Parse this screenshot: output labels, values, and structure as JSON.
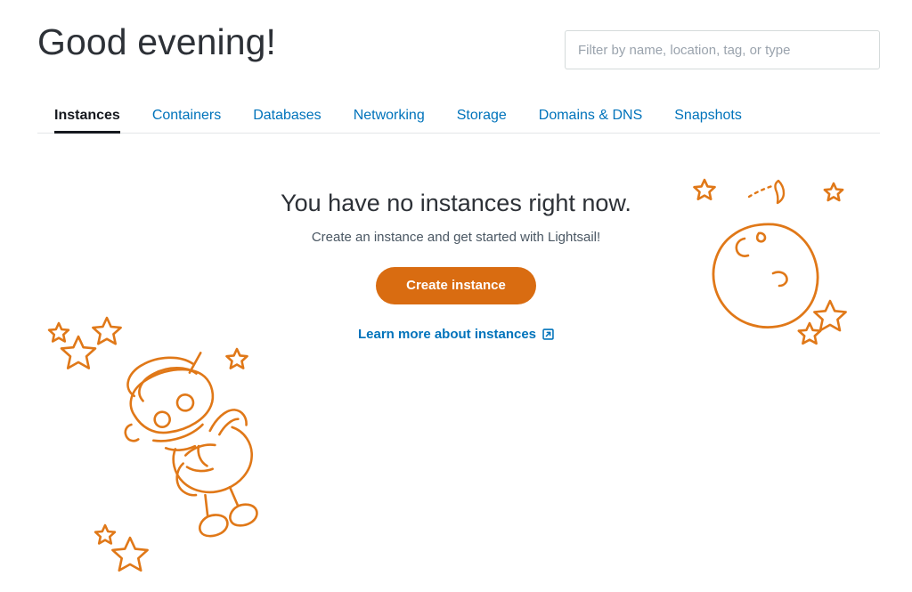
{
  "header": {
    "greeting": "Good evening!",
    "filter": {
      "placeholder": "Filter by name, location, tag, or type",
      "value": ""
    }
  },
  "tabs": [
    {
      "label": "Instances",
      "active": true
    },
    {
      "label": "Containers",
      "active": false
    },
    {
      "label": "Databases",
      "active": false
    },
    {
      "label": "Networking",
      "active": false
    },
    {
      "label": "Storage",
      "active": false
    },
    {
      "label": "Domains & DNS",
      "active": false
    },
    {
      "label": "Snapshots",
      "active": false
    }
  ],
  "empty_state": {
    "title": "You have no instances right now.",
    "subtitle": "Create an instance and get started with Lightsail!",
    "create_button": "Create instance",
    "learn_more_link": "Learn more about instances",
    "learn_more_icon": "external-link-icon"
  },
  "illustration": {
    "robot": "robot-astronaut-drawing",
    "planet": "planet-with-craters-drawing",
    "comet": "comet-with-dashed-trail",
    "stars": "outlined-five-point-stars"
  },
  "colors": {
    "accent_orange": "#d96c11",
    "link_blue": "#0073bb",
    "text_dark": "#16191f",
    "text_muted": "#4a5763",
    "placeholder_gray": "#9aa3ad",
    "border_gray": "#d5dbdb",
    "divider_gray": "#e4e6e8"
  }
}
